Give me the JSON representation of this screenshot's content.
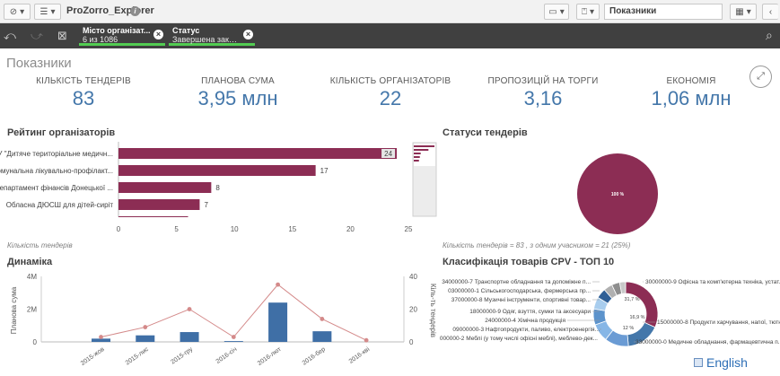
{
  "toolbar": {
    "app_title": "ProZorro_Explorer",
    "sheet_name": "Показники"
  },
  "selections": [
    {
      "field": "Місто організат...",
      "value": "6 из 1086"
    },
    {
      "field": "Статус",
      "value": "Завершена закуп..."
    }
  ],
  "sheet": {
    "title": "Показники"
  },
  "kpis": [
    {
      "label": "КІЛЬКІСТЬ ТЕНДЕРІВ",
      "value": "83"
    },
    {
      "label": "ПЛАНОВА СУМА",
      "value": "3,95 млн"
    },
    {
      "label": "КІЛЬКІСТЬ ОРГАНІЗАТОРІВ",
      "value": "22"
    },
    {
      "label": "ПРОПОЗИЦІЙ НА ТОРГИ",
      "value": "3,16"
    },
    {
      "label": "ЕКОНОМІЯ",
      "value": "1,06 млн"
    }
  ],
  "rating": {
    "title": "Рейтинг організаторів",
    "footnote": "Кількість тендерів",
    "bar_color": "#8c2d54"
  },
  "statuses": {
    "title": "Статуси тендерів",
    "footnote": "Кількість тендерів = 83 , з одним учасником = 21 (25%)",
    "slice_label": "100 %",
    "color": "#8c2d54"
  },
  "dynamics": {
    "title": "Динаміка",
    "ylabel_left": "Планова сума",
    "ylabel_right": "Кіль-ть тендерів",
    "bar_color": "#3f6fa6",
    "line_color": "#d48a8a"
  },
  "cpv": {
    "title": "Класифікація товарів CPV - ТОП 10",
    "labels_left": [
      "34000000-7 Транспортне обладнання та допоміжне п...",
      "03000000-1 Сільськогосподарська, фермерська пр...",
      "37000000-8 Музичні інструменти, спортивні товар...",
      "18000000-9 Одяг, взуття, сумки та аксесуари",
      "24000000-4 Хімічна продукція",
      "09000000-3 Нафтопродукти, паливо, електроенергія...",
      "39000000-2 Меблі (у тому числі офісні меблі), меблево-дек..."
    ],
    "labels_right": [
      "30000000-9 Офісна та комп'ютерна техніка, устат...",
      "15000000-8 Продукти харчування, напої, тютюн...",
      "33000000-0 Медичне обладнання, фармацевтична п..."
    ],
    "pct_labels": [
      "31,7 %",
      "16,9 %",
      "12 %"
    ]
  },
  "chart_data": [
    {
      "type": "bar",
      "orientation": "horizontal",
      "title": "Рейтинг організаторів",
      "xlabel": "Кількість тендерів",
      "categories": [
        "КУ \"Дитяче територіальне медичн...",
        "Комунальна лікувально-профілакт...",
        "Департамент фінансів Донецької ...",
        "Обласна ДЮСШ для дітей-сиріт"
      ],
      "values": [
        24,
        17,
        8,
        7,
        6
      ],
      "xlim": [
        0,
        25
      ],
      "xticks": [
        0,
        5,
        10,
        15,
        20,
        25
      ]
    },
    {
      "type": "pie",
      "title": "Статуси тендерів",
      "slices": [
        {
          "value": 100
        }
      ]
    },
    {
      "type": "bar",
      "title": "Динаміка",
      "categories": [
        "2015-жов",
        "2015-лис",
        "2015-гру",
        "2016-січ",
        "2016-лют",
        "2016-бер",
        "2016-кві"
      ],
      "series": [
        {
          "name": "Планова сума",
          "axis": "left",
          "type": "bar",
          "values": [
            200000,
            400000,
            600000,
            50000,
            2400000,
            650000,
            0
          ]
        },
        {
          "name": "Кіль-ть тендерів",
          "axis": "right",
          "type": "line",
          "values": [
            3,
            9,
            20,
            3,
            35,
            14,
            1
          ]
        }
      ],
      "ylim_left": [
        0,
        4000000
      ],
      "yticks_left": [
        "0",
        "2M",
        "4M"
      ],
      "ylim_right": [
        0,
        40
      ],
      "yticks_right": [
        "0",
        "20",
        "40"
      ]
    },
    {
      "type": "pie",
      "donut": true,
      "title": "Класифікація товарів CPV - ТОП 10",
      "slices": [
        {
          "name": "30000000-9",
          "value": 31.7,
          "color": "#8c2d54"
        },
        {
          "name": "15000000-8",
          "value": 16.9,
          "color": "#4477aa"
        },
        {
          "name": "33000000-0",
          "value": 12,
          "color": "#6a9bd4"
        },
        {
          "name": "39000000-2",
          "value": 9,
          "color": "#86b6e6"
        },
        {
          "name": "09000000-3",
          "value": 8,
          "color": "#5c93cc"
        },
        {
          "name": "24000000-4",
          "value": 6,
          "color": "#a8cdee"
        },
        {
          "name": "18000000-9",
          "value": 5,
          "color": "#2f5f96"
        },
        {
          "name": "37000000-8",
          "value": 4.4,
          "color": "#b0b0b0"
        },
        {
          "name": "03000000-1",
          "value": 4,
          "color": "#8e8e8e"
        },
        {
          "name": "34000000-7",
          "value": 3,
          "color": "#c8c8c8"
        }
      ]
    }
  ],
  "footer": {
    "language": "English"
  }
}
